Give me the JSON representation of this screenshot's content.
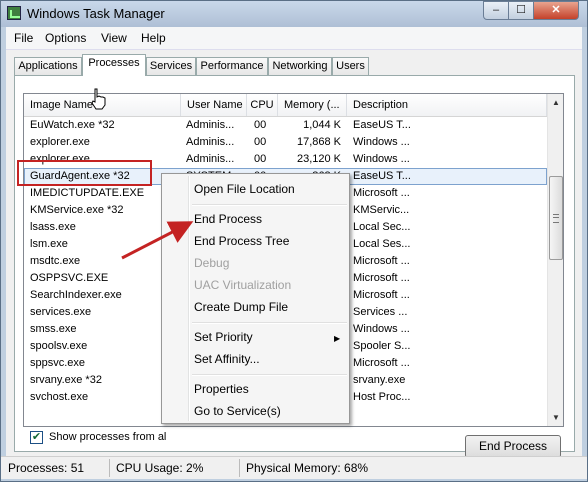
{
  "window": {
    "title": "Windows Task Manager"
  },
  "titlebar_buttons": {
    "min": "‒",
    "max": "☐",
    "close": "✕"
  },
  "menu": [
    "File",
    "Options",
    "View",
    "Help"
  ],
  "tabs": [
    "Applications",
    "Processes",
    "Services",
    "Performance",
    "Networking",
    "Users"
  ],
  "active_tab": "Processes",
  "columns": [
    "Image Name",
    "User Name",
    "CPU",
    "Memory (...",
    "Description"
  ],
  "processes": [
    {
      "name": "EuWatch.exe *32",
      "user": "Adminis...",
      "cpu": "00",
      "mem": "1,044 K",
      "desc": "EaseUS T..."
    },
    {
      "name": "explorer.exe",
      "user": "Adminis...",
      "cpu": "00",
      "mem": "17,868 K",
      "desc": "Windows ..."
    },
    {
      "name": "explorer.exe",
      "user": "Adminis...",
      "cpu": "00",
      "mem": "23,120 K",
      "desc": "Windows ..."
    },
    {
      "name": "GuardAgent.exe *32",
      "user": "SYSTEM",
      "cpu": "00",
      "mem": "868 K",
      "desc": "EaseUS T..."
    },
    {
      "name": "IMEDICTUPDATE.EXE",
      "user": "",
      "cpu": "",
      "mem": "",
      "desc": "Microsoft ..."
    },
    {
      "name": "KMService.exe *32",
      "user": "",
      "cpu": "",
      "mem": "",
      "desc": "KMServic..."
    },
    {
      "name": "lsass.exe",
      "user": "",
      "cpu": "",
      "mem": "",
      "desc": "Local Sec..."
    },
    {
      "name": "lsm.exe",
      "user": "",
      "cpu": "",
      "mem": "",
      "desc": "Local Ses..."
    },
    {
      "name": "msdtc.exe",
      "user": "",
      "cpu": "",
      "mem": "",
      "desc": "Microsoft ..."
    },
    {
      "name": "OSPPSVC.EXE",
      "user": "",
      "cpu": "",
      "mem": "",
      "desc": "Microsoft ..."
    },
    {
      "name": "SearchIndexer.exe",
      "user": "",
      "cpu": "",
      "mem": "",
      "desc": "Microsoft ..."
    },
    {
      "name": "services.exe",
      "user": "",
      "cpu": "",
      "mem": "",
      "desc": "Services ..."
    },
    {
      "name": "smss.exe",
      "user": "",
      "cpu": "",
      "mem": "",
      "desc": "Windows ..."
    },
    {
      "name": "spoolsv.exe",
      "user": "",
      "cpu": "",
      "mem": "",
      "desc": "Spooler S..."
    },
    {
      "name": "sppsvc.exe",
      "user": "",
      "cpu": "",
      "mem": "",
      "desc": "Microsoft ..."
    },
    {
      "name": "srvany.exe *32",
      "user": "",
      "cpu": "",
      "mem": "",
      "desc": "srvany.exe"
    },
    {
      "name": "svchost.exe",
      "user": "",
      "cpu": "",
      "mem": "",
      "desc": "Host Proc..."
    }
  ],
  "selected_process": "GuardAgent.exe *32",
  "show_all_label": "Show processes from al",
  "show_all_checked": true,
  "end_process_button": "End Process",
  "context_menu": {
    "open_file_location": "Open File Location",
    "end_process": "End Process",
    "end_process_tree": "End Process Tree",
    "debug": "Debug",
    "uac_virtualization": "UAC Virtualization",
    "create_dump_file": "Create Dump File",
    "set_priority": "Set Priority",
    "set_affinity": "Set Affinity...",
    "properties": "Properties",
    "go_to_service": "Go to Service(s)"
  },
  "status": {
    "processes": "Processes: 51",
    "cpu": "CPU Usage: 2%",
    "memory": "Physical Memory: 68%"
  },
  "colors": {
    "highlight_box": "#c42323",
    "annotation_arrow": "#c42323",
    "selection": "#e8f1fb"
  },
  "icons": [
    "task-manager-icon",
    "minimize-icon",
    "maximize-icon",
    "close-icon",
    "scroll-up-icon",
    "scroll-down-icon",
    "submenu-arrow-icon",
    "hand-cursor-icon",
    "annotation-arrow-icon"
  ]
}
